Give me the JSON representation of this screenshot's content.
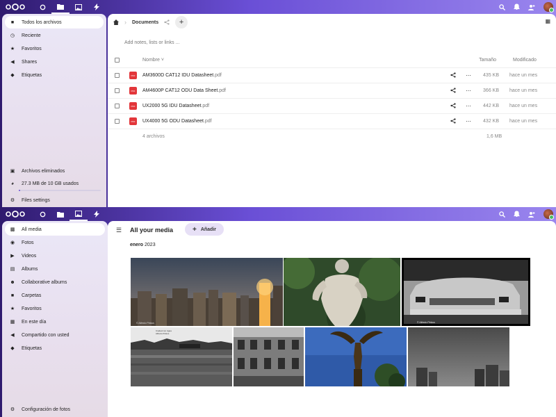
{
  "files_app": {
    "sidebar": {
      "items": [
        {
          "label": "Todos los archivos",
          "icon": "folder-icon",
          "active": true
        },
        {
          "label": "Reciente",
          "icon": "clock-icon"
        },
        {
          "label": "Favoritos",
          "icon": "star-icon"
        },
        {
          "label": "Shares",
          "icon": "share-icon"
        },
        {
          "label": "Etiquetas",
          "icon": "tag-icon"
        }
      ],
      "deleted": "Archivos eliminados",
      "quota": "27.3 MB de 10 GB usados",
      "quota_fraction": 0.003,
      "settings": "Files settings"
    },
    "breadcrumb": "Documents",
    "notes_placeholder": "Add notes, lists or links ...",
    "columns": {
      "name": "Nombre",
      "size": "Tamaño",
      "modified": "Modificado"
    },
    "files": [
      {
        "name": "AM3600D CAT12 IDU Datasheet",
        "ext": ".pdf",
        "size": "435 KB",
        "modified": "hace un mes"
      },
      {
        "name": "AM4600P CAT12 ODU Data Sheet",
        "ext": ".pdf",
        "size": "366 KB",
        "modified": "hace un mes"
      },
      {
        "name": "UX2000 5G IDU Datasheet",
        "ext": ".pdf",
        "size": "442 KB",
        "modified": "hace un mes"
      },
      {
        "name": "UX4000 5G ODU Datasheet",
        "ext": ".pdf",
        "size": "432 KB",
        "modified": "hace un mes"
      }
    ],
    "summary_count": "4 archivos",
    "summary_size": "1,6 MB"
  },
  "photos_app": {
    "sidebar": {
      "items": [
        {
          "label": "All media",
          "icon": "media-icon",
          "active": true
        },
        {
          "label": "Fotos",
          "icon": "camera-icon"
        },
        {
          "label": "Videos",
          "icon": "video-icon"
        },
        {
          "label": "Albums",
          "icon": "album-icon"
        },
        {
          "label": "Collaborative albums",
          "icon": "people-icon"
        },
        {
          "label": "Carpetas",
          "icon": "folder-icon"
        },
        {
          "label": "Favoritos",
          "icon": "star-icon"
        },
        {
          "label": "En este día",
          "icon": "calendar-icon"
        },
        {
          "label": "Compartido con usted",
          "icon": "share-icon"
        },
        {
          "label": "Etiquetas",
          "icon": "tag-icon"
        }
      ],
      "settings": "Configuración de fotos"
    },
    "title": "All your media",
    "add_button": "Añadir",
    "month_bold": "enero",
    "month_year": "2023",
    "photo_captions": [
      "© Alfredo Pinkus",
      "© Alfredo Pinkus",
      "Ciudad con Agua\nAlfredo Pinkus"
    ]
  },
  "colors": {
    "header": "#6a4fd6",
    "pdf_red": "#e2363a",
    "active_bg": "#ffffff"
  }
}
